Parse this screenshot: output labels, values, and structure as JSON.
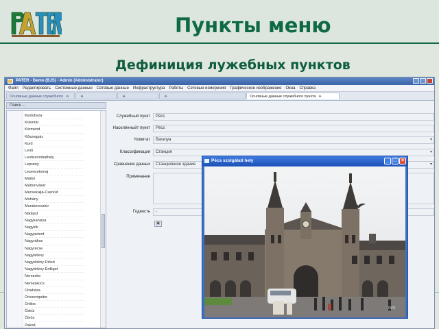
{
  "slide": {
    "title": "Пункты меню",
    "subtitle": "Дефиниция лужебных пунктов",
    "logo_text": "PATER"
  },
  "app": {
    "window_title": "PATER - Demo (BJS) - Admin (Administrator)",
    "menu": [
      "Файл",
      "Редактировать",
      "Системные данные",
      "Сетевые данные",
      "Инфраструктура",
      "Работы",
      "Сетевые измерения",
      "Графическое изображение",
      "Окна",
      "Справка"
    ],
    "tabs": [
      {
        "label": "Основные данные служебного",
        "pin": "ᵰ"
      },
      {
        "label": "",
        "pin": "ᵰ"
      },
      {
        "label": "",
        "pin": "ᵰ"
      },
      {
        "label": "",
        "pin": "ᵰ"
      },
      {
        "label": "Основные данные служебного пункта",
        "pin": "ᵰ"
      }
    ],
    "search_label": "Поиск ...",
    "list_items": [
      "Kisdobsza",
      "Kolontár",
      "Körmend",
      "Kőszegpác",
      "Kurd",
      "Lenti",
      "Lentiszombathely",
      "Lepsény",
      "Lesencetomaj",
      "Márkó",
      "Martonvásár",
      "Mecsekalja-Cserkút",
      "Mohány",
      "Murakeresztúr",
      "Nádasd",
      "Nagykanizsa",
      "Nagylók",
      "Nagypeterd",
      "Nagyrákos",
      "Nagyrécse",
      "Nagytétény",
      "Nagytétény-Diósd",
      "Nagytétény-Érdliget",
      "Nemeske",
      "Nemeskocs",
      "Ortaháza",
      "Őriszentpéter",
      "Örtilos",
      "Ösküi",
      "Ötvös",
      "Pakod",
      "Pankasz"
    ],
    "form": {
      "service_point_label": "Служебный пункт",
      "service_point_value": "Pécs",
      "settlement_label": "Населённыйт пункт",
      "settlement_value": "Pécs",
      "county_label": "Комитат",
      "county_value": "Baranya",
      "classification_label": "Классификация",
      "classification_value": "Станция",
      "comparison_label": "Сравнение данных",
      "comparison_value": "Станционное здание",
      "note_label": "Примечание",
      "validity_label": "Годность",
      "validity_value": "-"
    }
  },
  "photo_window": {
    "title": "Pécs szolgálati hely",
    "watermark": "IMS\nRailwayFacts"
  },
  "colors": {
    "accent": "#0f6a44",
    "window_blue": "#3d7ae0"
  }
}
